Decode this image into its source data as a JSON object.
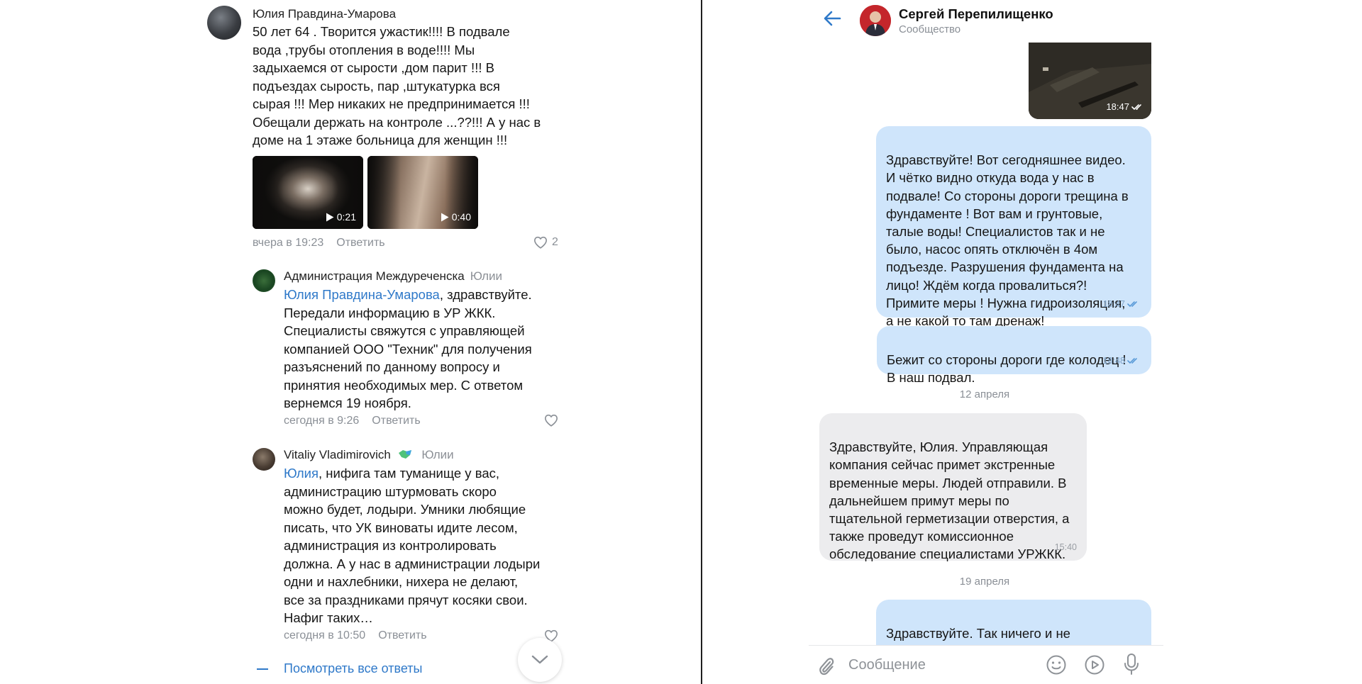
{
  "comments": {
    "main": {
      "author": "Юлия Правдина-Умарова",
      "text": "50 лет 64 . Творится ужастик!!!! В  подвале\nвода ,трубы отопления в воде!!!!  Мы\nзадыхаемся от сырости ,дом парит !!! В\nподъездах сырость, пар ,штукатурка вся\nсырая !!! Мер никаких не предпринимается !!!\nОбещали держать на контроле ...??!!! А у нас в\nдоме на 1 этаже больница для женщин !!!",
      "videos": [
        {
          "duration": "0:21"
        },
        {
          "duration": "0:40"
        }
      ],
      "time": "вчера в 19:23",
      "reply_label": "Ответить",
      "likes": "2"
    },
    "reply1": {
      "author": "Администрация Междуреченска",
      "reply_to": "Юлии",
      "mention": "Юлия Правдина-Умарова",
      "text_first": ", здравствуйте.",
      "text_rest": "Передали информацию в УР ЖКК.\nСпециалисты свяжутся с управляющей\nкомпанией ООО \"Техник\" для получения\nразъяснений по данному вопросу и\nпринятия необходимых мер. С ответом\nвернемся 19 ноября.",
      "time": "сегодня в 9:26",
      "reply_label": "Ответить"
    },
    "reply2": {
      "author": "Vitaliy Vladimirovich",
      "reply_to": "Юлии",
      "mention": "Юлия",
      "text_first": ", нифига там туманище у вас,",
      "text_rest": "администрацию штурмовать скоро\nможно будет, лодыри. Умники любящие\nписать, что УК виноваты идите лесом,\nадминистрация из контролировать\nдолжна. А у нас в администрации лодыри\nодни и нахлебники, нихера не делают,\nвсе за праздниками прячут косяки свои.\nНафиг таких…",
      "time": "сегодня в 10:50",
      "reply_label": "Ответить"
    },
    "show_all_label": "Посмотреть все ответы"
  },
  "chat": {
    "title": "Сергей Перепилищенко",
    "subtitle": "Сообщество",
    "image_time": "18:47",
    "messages": [
      {
        "dir": "out",
        "text": "Здравствуйте! Вот сегодняшнее видео.\nИ чётко видно откуда вода у нас в\nподвале! Со стороны дороги трещина в\nфундаменте ! Вот вам и грунтовые,\nталые воды!  Специалистов так и не\nбыло, насос опять отключён в 4ом\nподъезде. Разрушения фундамента на\nлицо! Ждём когда провалиться?!\nПримите меры ! Нужна гидроизоляция,\nа не какой то там дренаж!",
        "time": "18:47"
      },
      {
        "dir": "out",
        "text": "Бежит со стороны дороги где колодец !\nВ наш подвал.",
        "time": "18:48"
      },
      {
        "dir": "in",
        "text": "Здравствуйте, Юлия. Управляющая\nкомпания сейчас примет экстренные\nвременные меры. Людей отправили. В\nдальнейшем примут меры по\nтщательной герметизации отверстия, а\nтакже проведут комиссионное\nобследование специалистами УРЖКК.",
        "time": "15:40"
      },
      {
        "dir": "out",
        "text": "Здравствуйте.  Так ничего и не\nсделали! И никто не приходит на"
      }
    ],
    "date_separators": [
      "12 апреля",
      "19 апреля"
    ],
    "input_placeholder": "Сообщение"
  },
  "colors": {
    "link": "#2f79c9",
    "bubble_out": "#cfe5fb",
    "bubble_in": "#ececee",
    "meta_gray": "#8a8f96",
    "community_red": "#c4262b"
  },
  "icons": [
    "heart-icon",
    "play-icon",
    "chevron-down-icon",
    "back-arrow-icon",
    "double-check-icon",
    "paperclip-icon",
    "emoji-icon",
    "video-message-icon",
    "microphone-icon"
  ]
}
